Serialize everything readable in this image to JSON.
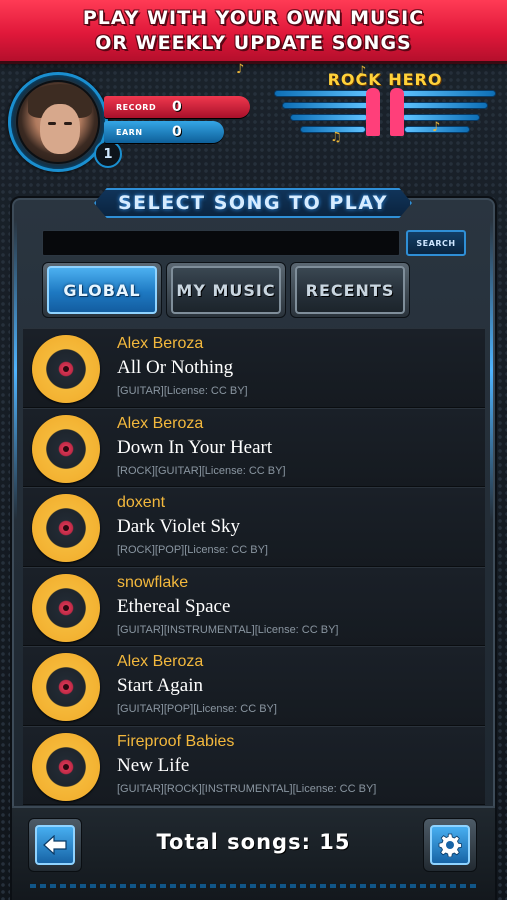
{
  "banner": {
    "line1": "PLAY WITH YOUR OWN MUSIC",
    "line2": "OR WEEKLY UPDATE SONGS"
  },
  "profile": {
    "level": "1",
    "record_label": "RECORD",
    "record_value": "0",
    "earn_label": "EARN",
    "earn_value": "0"
  },
  "logo": {
    "title": "ROCK HERO"
  },
  "panel": {
    "title": "SELECT SONG TO PLAY"
  },
  "search": {
    "value": "",
    "button_label": "SEARCH"
  },
  "tabs": [
    {
      "label": "GLOBAL",
      "active": true
    },
    {
      "label": "MY MUSIC",
      "active": false
    },
    {
      "label": "RECENTS",
      "active": false
    }
  ],
  "songs": [
    {
      "artist": "Alex Beroza",
      "title": "All Or Nothing",
      "tags": "[GUITAR][License: CC BY]"
    },
    {
      "artist": "Alex Beroza",
      "title": "Down In Your Heart",
      "tags": "[ROCK][GUITAR][License: CC BY]"
    },
    {
      "artist": "doxent",
      "title": "Dark Violet Sky",
      "tags": "[ROCK][POP][License: CC BY]"
    },
    {
      "artist": "snowflake",
      "title": "Ethereal Space",
      "tags": "[GUITAR][INSTRUMENTAL][License: CC BY]"
    },
    {
      "artist": "Alex Beroza",
      "title": "Start Again",
      "tags": "[GUITAR][POP][License: CC BY]"
    },
    {
      "artist": "Fireproof Babies",
      "title": "New Life",
      "tags": "[GUITAR][ROCK][INSTRUMENTAL][License: CC BY]"
    }
  ],
  "footer": {
    "total_text": "Total songs: 15",
    "back_icon": "arrow-left-icon",
    "settings_icon": "gear-icon"
  },
  "colors": {
    "accent_blue": "#1e79c2",
    "accent_red": "#e0183a",
    "artist_gold": "#f3b83d"
  }
}
